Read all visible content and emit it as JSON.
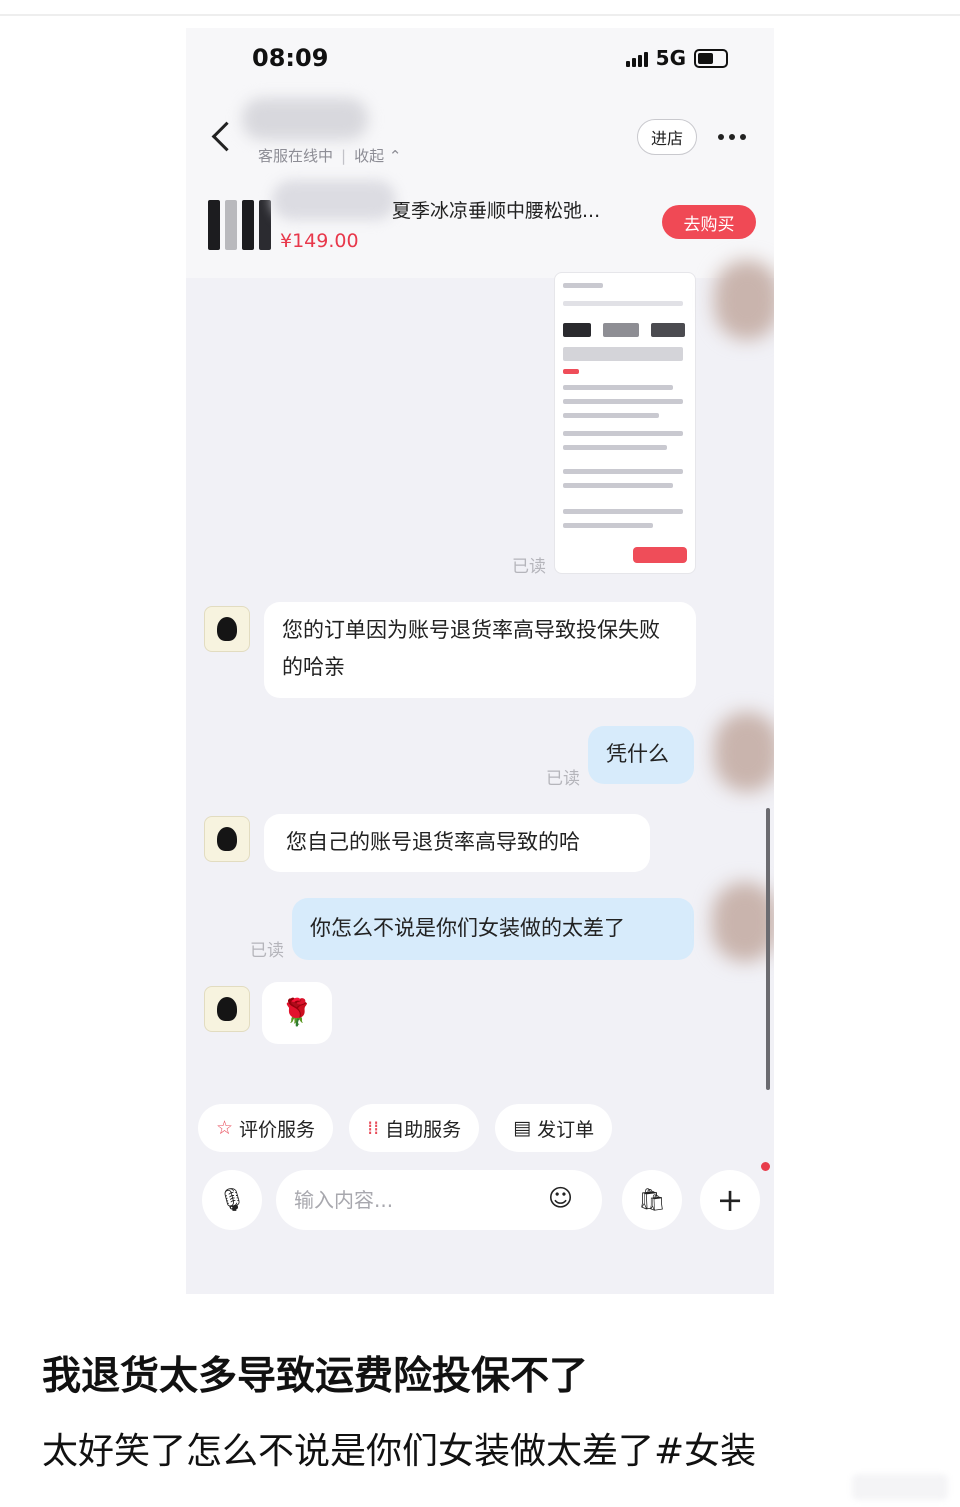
{
  "status_bar": {
    "time": "08:09",
    "network": "5G"
  },
  "header": {
    "shop_status": "客服在线中",
    "collapse_label": "收起 ⌃",
    "enter_shop_label": "进店"
  },
  "product": {
    "title": "夏季冰凉垂顺中腰松弛...",
    "price": "¥149.00",
    "buy_label": "去购买"
  },
  "chat": {
    "read_label": "已读",
    "messages": [
      {
        "from": "shop",
        "text": "您的订单因为账号退货率高导致投保失败的哈亲"
      },
      {
        "from": "user",
        "text": "凭什么"
      },
      {
        "from": "shop",
        "text": "您自己的账号退货率高导致的哈"
      },
      {
        "from": "user",
        "text": "你怎么不说是你们女装做的太差了"
      },
      {
        "from": "shop",
        "text": "🌹"
      }
    ]
  },
  "quick_actions": [
    {
      "label": "评价服务",
      "icon": "star-outline-icon",
      "glyph": "☆"
    },
    {
      "label": "自助服务",
      "icon": "grid-icon",
      "glyph": "⁞⁞"
    },
    {
      "label": "发订单",
      "icon": "clipboard-icon",
      "glyph": "▤"
    }
  ],
  "input": {
    "placeholder": "输入内容..."
  },
  "caption": {
    "line1": "我退货太多导致运费险投保不了",
    "line2": "太好笑了怎么不说是你们女装做太差了",
    "hashtag": "#女装"
  }
}
